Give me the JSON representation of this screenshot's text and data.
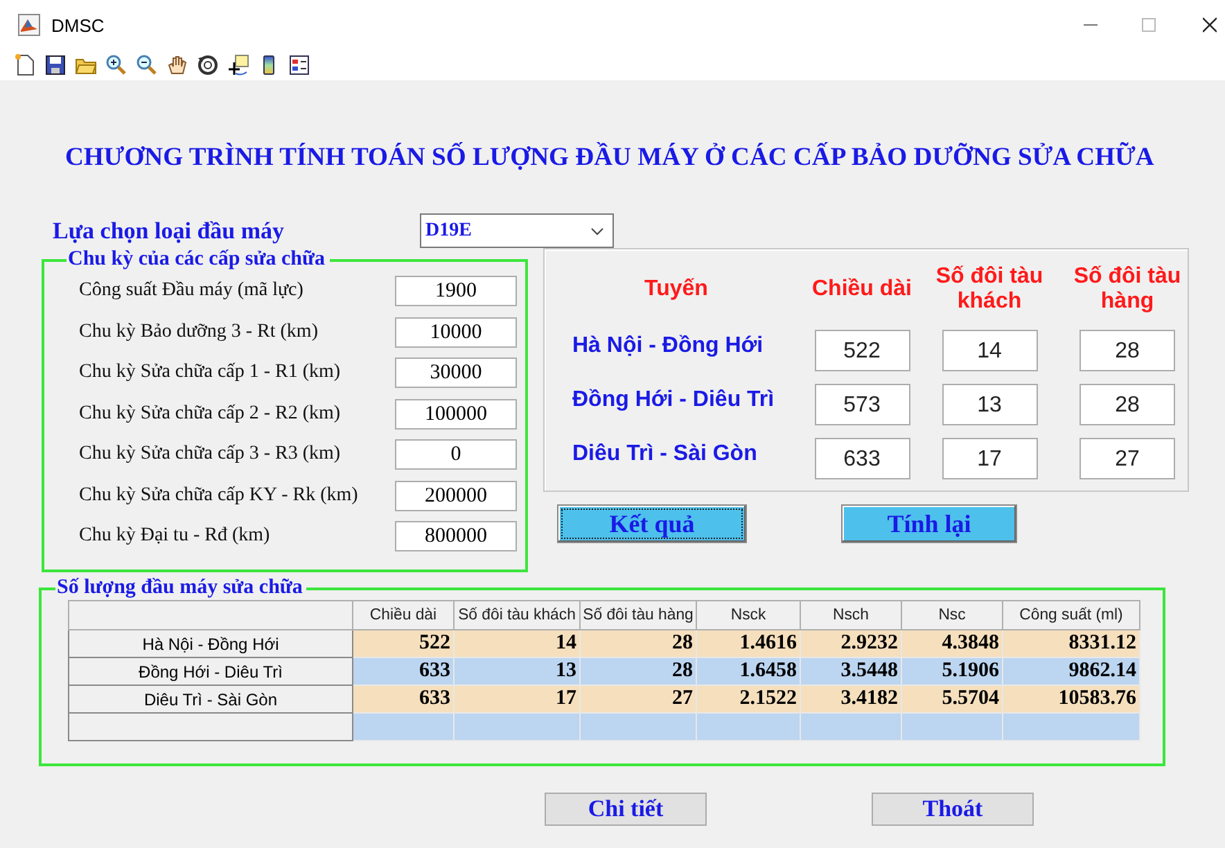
{
  "window": {
    "title": "DMSC"
  },
  "heading": "CHƯƠNG TRÌNH TÍNH TOÁN SỐ LƯỢNG ĐẦU MÁY Ở CÁC CẤP BẢO DƯỠNG SỬA CHỮA",
  "locomotive_select": {
    "label": "Lựa chọn loại đầu máy",
    "value": "D19E"
  },
  "cycle_panel": {
    "title": "Chu kỳ của các cấp sửa chữa",
    "fields": [
      {
        "label": "Công suất Đầu máy (mã lực)",
        "value": "1900"
      },
      {
        "label": "Chu kỳ Bảo dưỡng 3 - Rt (km)",
        "value": "10000"
      },
      {
        "label": "Chu kỳ Sửa chữa cấp 1 - R1 (km)",
        "value": "30000"
      },
      {
        "label": "Chu kỳ Sửa chữa cấp 2 - R2 (km)",
        "value": "100000"
      },
      {
        "label": "Chu kỳ Sửa chữa cấp 3 - R3 (km)",
        "value": "0"
      },
      {
        "label": "Chu kỳ Sửa chữa cấp KY - Rk (km)",
        "value": "200000"
      },
      {
        "label": "Chu kỳ Đại tu - Rđ (km)",
        "value": "800000"
      }
    ]
  },
  "routes_panel": {
    "columns": [
      "Tuyến",
      "Chiều dài",
      "Số đôi tàu khách",
      "Số đôi tàu hàng"
    ],
    "rows": [
      {
        "name": "Hà Nội - Đồng Hới",
        "values": [
          "522",
          "14",
          "28"
        ]
      },
      {
        "name": "Đồng Hới - Diêu Trì",
        "values": [
          "573",
          "13",
          "28"
        ]
      },
      {
        "name": "Diêu Trì - Sài Gòn",
        "values": [
          "633",
          "17",
          "27"
        ]
      }
    ]
  },
  "action_buttons": [
    {
      "label": "Kết quả",
      "focused": true
    },
    {
      "label": "Tính lại",
      "focused": false
    }
  ],
  "results_panel": {
    "title": "Số lượng đầu máy sửa chữa",
    "columns": [
      "Chiều dài",
      "Số đôi tàu khách",
      "Số đôi tàu hàng",
      "Nsck",
      "Nsch",
      "Nsc",
      "Công suất (ml)"
    ],
    "rows": [
      {
        "name": "Hà Nội - Đồng Hới",
        "cells": [
          "522",
          "14",
          "28",
          "1.4616",
          "2.9232",
          "4.3848",
          "8331.12"
        ]
      },
      {
        "name": "Đồng Hới - Diêu Trì",
        "cells": [
          "633",
          "13",
          "28",
          "1.6458",
          "3.5448",
          "5.1906",
          "9862.14"
        ]
      },
      {
        "name": "Diêu Trì - Sài Gòn",
        "cells": [
          "633",
          "17",
          "27",
          "2.1522",
          "3.4182",
          "5.5704",
          "10583.76"
        ]
      }
    ]
  },
  "footer_buttons": [
    {
      "label": "Chi tiết"
    },
    {
      "label": "Thoát"
    }
  ]
}
